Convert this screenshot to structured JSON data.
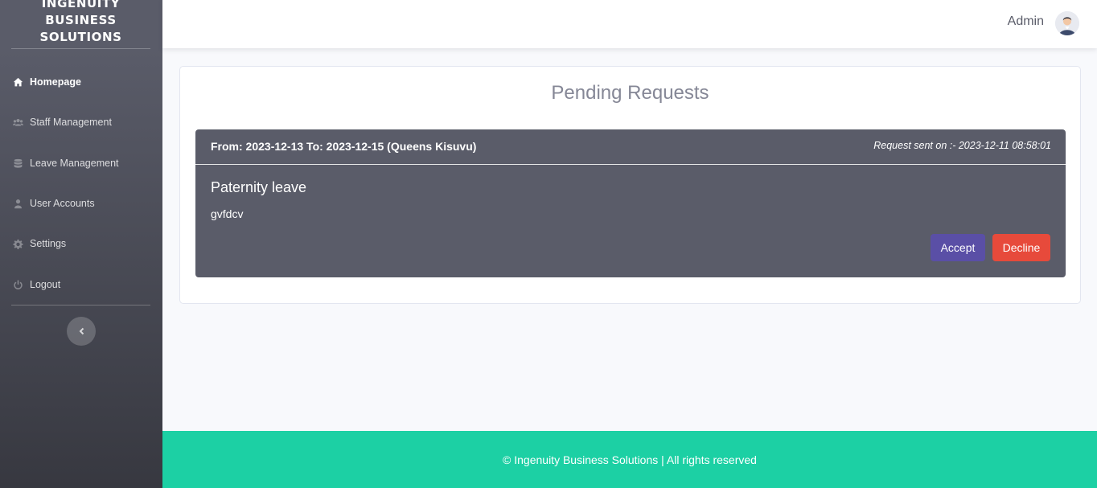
{
  "brand": {
    "lines": [
      "INGENUITY",
      "BUSINESS",
      "SOLUTIONS"
    ]
  },
  "sidebar": {
    "items": [
      {
        "label": "Homepage",
        "icon": "home-icon",
        "active": true
      },
      {
        "label": "Staff Management",
        "icon": "users-icon"
      },
      {
        "label": "Leave Management",
        "icon": "database-icon"
      },
      {
        "label": "User Accounts",
        "icon": "user-icon"
      },
      {
        "label": "Settings",
        "icon": "gear-icon"
      },
      {
        "label": "Logout",
        "icon": "power-icon"
      }
    ],
    "toggle_icon": "chevron-left-icon"
  },
  "topbar": {
    "user_name": "Admin",
    "avatar_icon": "user-avatar"
  },
  "main": {
    "title": "Pending Requests",
    "requests": [
      {
        "range": "From: 2023-12-13 To: 2023-12-15 (Queens Kisuvu)",
        "sent": "Request sent on :- 2023-12-11 08:58:01",
        "type": "Paternity leave",
        "description": "gvfdcv",
        "accept_label": "Accept",
        "decline_label": "Decline"
      }
    ]
  },
  "footer": {
    "text": "© Ingenuity Business Solutions | All rights reserved"
  },
  "colors": {
    "sidebar": "#5a5c69",
    "accept": "#5a4fa6",
    "decline": "#e74a3b",
    "footer": "#1cd0a4"
  }
}
